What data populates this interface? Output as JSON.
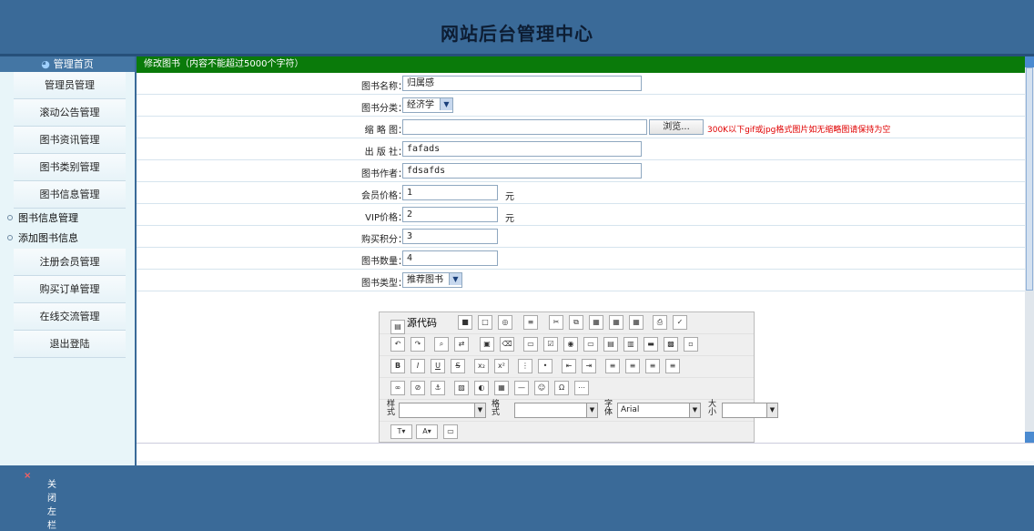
{
  "header": {
    "title": "网站后台管理中心"
  },
  "sidebar": {
    "home": "管理首页",
    "items": [
      "管理员管理",
      "滚动公告管理",
      "图书资讯管理",
      "图书类别管理",
      "图书信息管理"
    ],
    "subitems": [
      "图书信息管理",
      "添加图书信息"
    ],
    "items2": [
      "注册会员管理",
      "购买订单管理",
      "在线交流管理",
      "退出登陆"
    ]
  },
  "form": {
    "title": "修改图书（内容不能超过5000个字符）",
    "name_label": "图书名称：",
    "name_value": "归属感",
    "cat_label": "图书分类：",
    "cat_value": "经济学",
    "thumb_label": "缩 略 图：",
    "browse": "浏览...",
    "thumb_hint": "300K以下gif或jpg格式图片如无缩略图请保持为空",
    "pub_label": "出 版 社：",
    "pub_value": "fafads",
    "author_label": "图书作者：",
    "author_value": "fdsafds",
    "price_label": "会员价格：",
    "price_value": "1",
    "unit": "元",
    "vip_label": "VIP价格：",
    "vip_value": "2",
    "points_label": "购买积分：",
    "points_value": "3",
    "qty_label": "图书数量：",
    "qty_value": "4",
    "type_label": "图书类型：",
    "type_value": "推荐图书"
  },
  "editor": {
    "source": "源代码",
    "style_label": "样式",
    "format_label": "格式",
    "font_label": "字体",
    "font_value": "Arial",
    "size_label": "大小"
  },
  "footer": {
    "close": "关闭左栏",
    "close_mark": "×"
  }
}
